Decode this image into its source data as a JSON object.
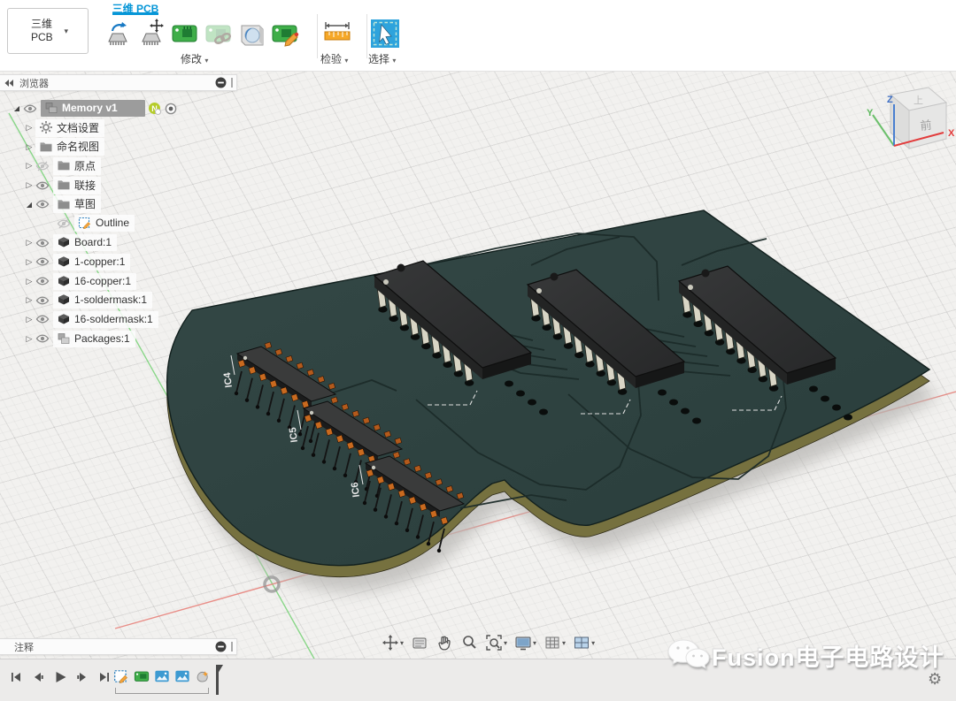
{
  "colors": {
    "accent": "#0696d7",
    "board_top": "#2e4241",
    "board_edge": "#76713f",
    "pcb_trace": "#1c2b29",
    "chip_body": "#2f3131",
    "pin_ivory": "#d8d5c5",
    "pad_copper": "#b35a1c",
    "axis_x_red": "#e8837c",
    "axis_y_green": "#6fd06f",
    "select_blue": "#2ea3dc"
  },
  "header": {
    "workspace_switcher": {
      "line1": "三维",
      "line2": "PCB",
      "caret": "▾"
    },
    "active_tab": "三维 PCB",
    "groups": [
      {
        "label": "修改",
        "caret": "▾",
        "icons": [
          "flip-component-icon",
          "move-component-icon",
          "pcb-board-icon",
          "linked-board-icon",
          "push-3d-body-icon",
          "edit-board-icon"
        ]
      },
      {
        "label": "检验",
        "caret": "▾",
        "icons": [
          "measure-icon"
        ]
      },
      {
        "label": "选择",
        "caret": "▾",
        "icons": [
          "select-icon"
        ]
      }
    ]
  },
  "browser": {
    "title": "浏览器",
    "header_icons": [
      "collapse-panel-icon",
      "hide-panel-icon",
      "panel-grip"
    ],
    "rows": [
      {
        "label": "Memory v1",
        "level": 0,
        "expander": "expanded",
        "eye": "visible",
        "icon": "component",
        "selected": true,
        "badge_text": "N",
        "badges": [
          "new-version-badge",
          "activate-component-radio"
        ]
      },
      {
        "label": "文档设置",
        "level": 1,
        "expander": "collapsed",
        "eye": "none",
        "icon": "gear",
        "selected": false
      },
      {
        "label": "命名视图",
        "level": 1,
        "expander": "collapsed",
        "eye": "none",
        "icon": "folder",
        "selected": false
      },
      {
        "label": "原点",
        "level": 1,
        "expander": "collapsed",
        "eye": "hidden",
        "icon": "folder",
        "selected": false
      },
      {
        "label": "联接",
        "level": 1,
        "expander": "collapsed",
        "eye": "visible",
        "icon": "folder",
        "selected": false
      },
      {
        "label": "草图",
        "level": 1,
        "expander": "expanded",
        "eye": "visible",
        "icon": "folder",
        "selected": false
      },
      {
        "label": "Outline",
        "level": 2,
        "expander": "none",
        "eye": "hidden",
        "icon": "sketch",
        "selected": false
      },
      {
        "label": "Board:1",
        "level": 1,
        "expander": "collapsed",
        "eye": "visible",
        "icon": "body",
        "selected": false
      },
      {
        "label": "1-copper:1",
        "level": 1,
        "expander": "collapsed",
        "eye": "visible",
        "icon": "body",
        "selected": false
      },
      {
        "label": "16-copper:1",
        "level": 1,
        "expander": "collapsed",
        "eye": "visible",
        "icon": "body",
        "selected": false
      },
      {
        "label": "1-soldermask:1",
        "level": 1,
        "expander": "collapsed",
        "eye": "visible",
        "icon": "body",
        "selected": false
      },
      {
        "label": "16-soldermask:1",
        "level": 1,
        "expander": "collapsed",
        "eye": "visible",
        "icon": "body",
        "selected": false
      },
      {
        "label": "Packages:1",
        "level": 1,
        "expander": "collapsed",
        "eye": "visible",
        "icon": "packages",
        "selected": false
      }
    ]
  },
  "viewport": {
    "silkscreen_labels": [
      "IC4",
      "IC5",
      "IC6"
    ],
    "view_cube": {
      "front_label": "前",
      "top_label": "上",
      "axis_x": "X",
      "axis_y": "Y",
      "axis_z": "Z"
    }
  },
  "comments_bar": {
    "label": "注释",
    "icons": [
      "hide-panel-icon",
      "panel-grip"
    ]
  },
  "nav_toolbar": {
    "caret": "▾",
    "items": [
      {
        "icon": "orbit-icon",
        "caret": true
      },
      {
        "icon": "look-at-icon",
        "caret": false
      },
      {
        "icon": "pan-icon",
        "caret": false
      },
      {
        "icon": "zoom-icon",
        "caret": false
      },
      {
        "icon": "fit-icon",
        "caret": true
      },
      {
        "icon": "display-settings-icon",
        "caret": true
      },
      {
        "icon": "grid-settings-icon",
        "caret": true
      },
      {
        "icon": "viewports-icon",
        "caret": true
      }
    ]
  },
  "timeline": {
    "playback": [
      "go-to-start-icon",
      "step-back-icon",
      "play-icon",
      "step-forward-icon",
      "go-to-end-icon"
    ],
    "items": [
      "sketch-feature-icon",
      "board-feature-icon",
      "image-feature-icon",
      "image-feature-icon",
      "form-feature-icon"
    ],
    "settings_icon": "gear-icon",
    "settings_glyph": "⚙"
  },
  "watermark": {
    "icon": "wechat-icon",
    "text": "Fusion电子电路设计"
  }
}
